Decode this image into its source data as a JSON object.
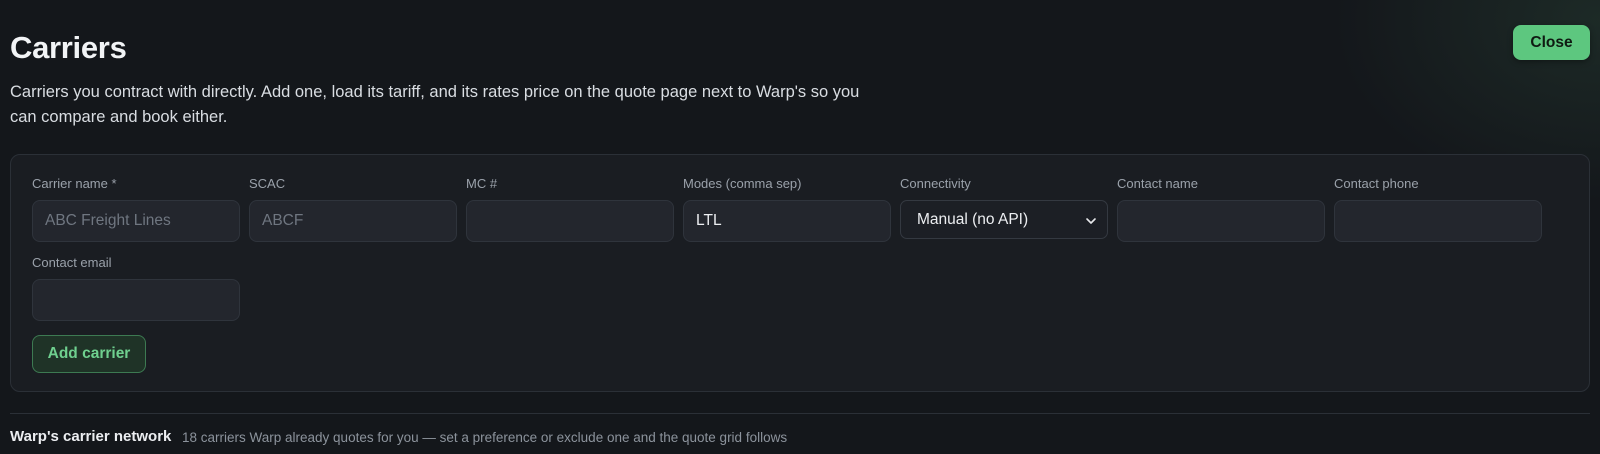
{
  "header": {
    "title": "Carriers",
    "subtitle": "Carriers you contract with directly. Add one, load its tariff, and its rates price on the quote page next to Warp's so you can compare and book either.",
    "close_label": "Close"
  },
  "form": {
    "carrier_name": {
      "label": "Carrier name *",
      "placeholder": "ABC Freight Lines",
      "value": ""
    },
    "scac": {
      "label": "SCAC",
      "placeholder": "ABCF",
      "value": ""
    },
    "mc": {
      "label": "MC #",
      "placeholder": "",
      "value": ""
    },
    "modes": {
      "label": "Modes (comma sep)",
      "placeholder": "",
      "value": "LTL"
    },
    "connectivity": {
      "label": "Connectivity",
      "selected": "Manual (no API)"
    },
    "contact_name": {
      "label": "Contact name",
      "placeholder": "",
      "value": ""
    },
    "contact_phone": {
      "label": "Contact phone",
      "placeholder": "",
      "value": ""
    },
    "contact_email": {
      "label": "Contact email",
      "placeholder": "",
      "value": ""
    },
    "submit_label": "Add carrier"
  },
  "network": {
    "title": "Warp's carrier network",
    "description": "18 carriers Warp already quotes for you — set a preference or exclude one and the quote grid follows"
  },
  "colors": {
    "accent": "#5dc77f",
    "background": "#14171b",
    "card": "#1a1d22"
  }
}
